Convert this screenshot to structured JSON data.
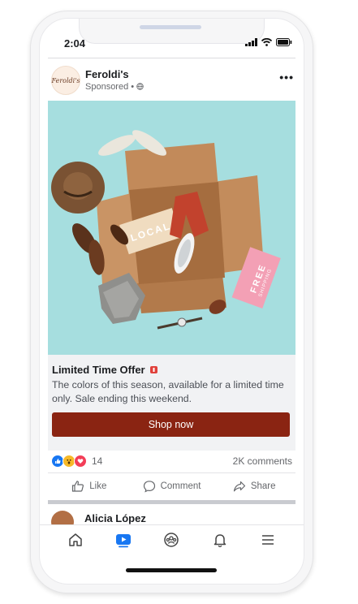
{
  "status": {
    "time": "2:04"
  },
  "post": {
    "brand": "Feroldi's",
    "avatar_text": "Feroldi's",
    "sponsored": "Sponsored • ",
    "more": "•••",
    "image_texts": {
      "local": "LOCAL",
      "free": "FREE",
      "shipping": "SHIPPING"
    },
    "offer_title": "Limited Time Offer",
    "description": "The colors of this season, available for a limited time only. Sale ending this weekend.",
    "cta": "Shop now",
    "reactions_count": "14",
    "comments": "2K comments",
    "actions": {
      "like": "Like",
      "comment": "Comment",
      "share": "Share"
    }
  },
  "next_post": {
    "name": "Alicia López"
  },
  "colors": {
    "cta_bg": "#8a2412",
    "image_bg": "#a6dedf",
    "accent": "#1877f2"
  }
}
